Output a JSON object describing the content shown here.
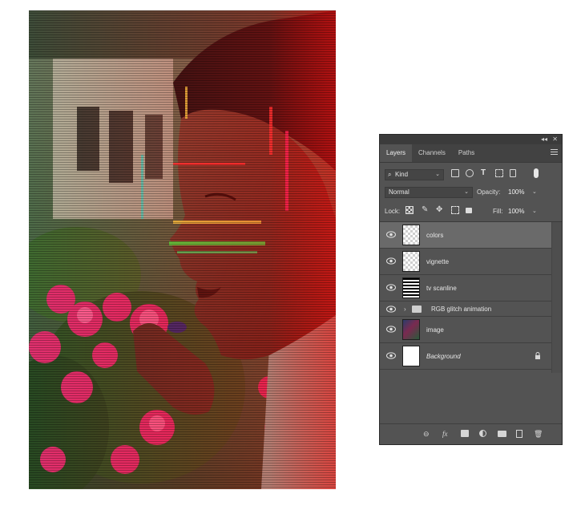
{
  "panel": {
    "collapse": "◂◂",
    "close": "✕",
    "tabs": [
      {
        "label": "Layers",
        "active": true
      },
      {
        "label": "Channels",
        "active": false
      },
      {
        "label": "Paths",
        "active": false
      }
    ],
    "filter": {
      "kind_label": "Kind"
    },
    "blend_mode": "Normal",
    "opacity": {
      "label": "Opacity:",
      "value": "100%"
    },
    "lock": {
      "label": "Lock:"
    },
    "fill": {
      "label": "Fill:",
      "value": "100%"
    },
    "layers": [
      {
        "name": "colors",
        "thumb": "checker",
        "selected": true
      },
      {
        "name": "vignette",
        "thumb": "checker"
      },
      {
        "name": "tv scanline",
        "thumb": "lines"
      },
      {
        "name": "RGB glitch animation",
        "type": "group"
      },
      {
        "name": "image",
        "thumb": "photo"
      },
      {
        "name": "Background",
        "thumb": "white",
        "locked": true
      }
    ],
    "bottom_icons": [
      "link-icon",
      "fx-icon",
      "mask-icon",
      "adjustment-icon",
      "folder-icon",
      "new-layer-icon",
      "trash-icon"
    ]
  }
}
